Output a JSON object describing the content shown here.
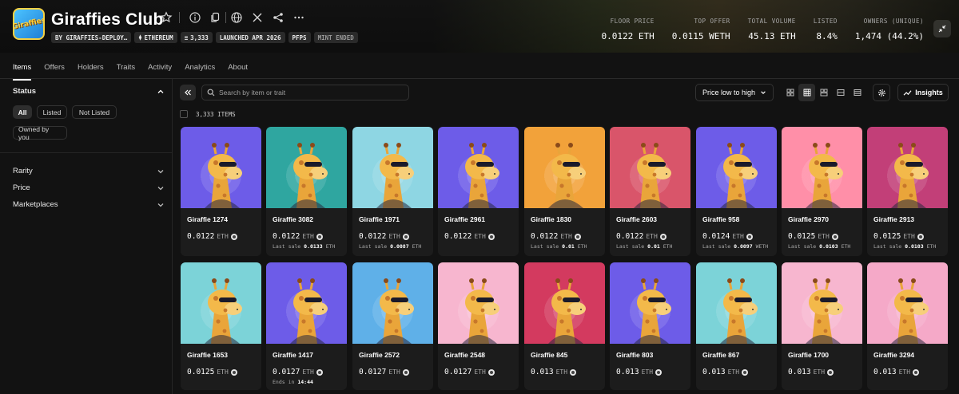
{
  "collection": {
    "logo_text": "Giraffies",
    "title": "Giraffies Club",
    "chips": [
      {
        "label": "BY GIRAFFIES-DEPLOY…",
        "icon": ""
      },
      {
        "label": "ETHEREUM",
        "icon": "ethereum-icon"
      },
      {
        "label": "3,333",
        "icon": "stack-icon"
      },
      {
        "label": "LAUNCHED APR 2026",
        "icon": ""
      },
      {
        "label": "PFPS",
        "icon": ""
      },
      {
        "label": "MINT ENDED",
        "icon": ""
      }
    ],
    "stats": [
      {
        "label": "FLOOR PRICE",
        "value": "0.0122 ETH"
      },
      {
        "label": "TOP OFFER",
        "value": "0.0115 WETH"
      },
      {
        "label": "TOTAL VOLUME",
        "value": "45.13 ETH"
      },
      {
        "label": "LISTED",
        "value": "8.4%"
      },
      {
        "label": "OWNERS (UNIQUE)",
        "value": "1,474 (44.2%)"
      }
    ]
  },
  "tabs": [
    "Items",
    "Offers",
    "Holders",
    "Traits",
    "Activity",
    "Analytics",
    "About"
  ],
  "sidebar": {
    "status_label": "Status",
    "status_options": [
      "All",
      "Listed",
      "Not Listed",
      "Owned by you"
    ],
    "filters": [
      "Rarity",
      "Price",
      "Marketplaces"
    ]
  },
  "toolbar": {
    "search_placeholder": "Search by item or trait",
    "sort_label": "Price low to high",
    "insights_label": "Insights",
    "items_count": "3,333 ITEMS"
  },
  "cards": [
    {
      "name": "Giraffie 1274",
      "price": "0.0122",
      "unit": "ETH",
      "sub_prefix": "",
      "sub_value": "",
      "sub_unit": ""
    },
    {
      "name": "Giraffie 3082",
      "price": "0.0122",
      "unit": "ETH",
      "sub_prefix": "Last sale",
      "sub_value": "0.0133",
      "sub_unit": "ETH"
    },
    {
      "name": "Giraffie 1971",
      "price": "0.0122",
      "unit": "ETH",
      "sub_prefix": "Last sale",
      "sub_value": "0.0087",
      "sub_unit": "ETH"
    },
    {
      "name": "Giraffie 2961",
      "price": "0.0122",
      "unit": "ETH",
      "sub_prefix": "",
      "sub_value": "",
      "sub_unit": ""
    },
    {
      "name": "Giraffie 1830",
      "price": "0.0122",
      "unit": "ETH",
      "sub_prefix": "Last sale",
      "sub_value": "0.01",
      "sub_unit": "ETH"
    },
    {
      "name": "Giraffie 2603",
      "price": "0.0122",
      "unit": "ETH",
      "sub_prefix": "Last sale",
      "sub_value": "0.01",
      "sub_unit": "ETH"
    },
    {
      "name": "Giraffie 958",
      "price": "0.0124",
      "unit": "ETH",
      "sub_prefix": "Last sale",
      "sub_value": "0.0097",
      "sub_unit": "WETH"
    },
    {
      "name": "Giraffie 2970",
      "price": "0.0125",
      "unit": "ETH",
      "sub_prefix": "Last sale",
      "sub_value": "0.0103",
      "sub_unit": "ETH"
    },
    {
      "name": "Giraffie 2913",
      "price": "0.0125",
      "unit": "ETH",
      "sub_prefix": "Last sale",
      "sub_value": "0.0103",
      "sub_unit": "ETH"
    },
    {
      "name": "Giraffie 1653",
      "price": "0.0125",
      "unit": "ETH",
      "sub_prefix": "",
      "sub_value": "",
      "sub_unit": ""
    },
    {
      "name": "Giraffie 1417",
      "price": "0.0127",
      "unit": "ETH",
      "sub_prefix": "Ends in",
      "sub_value": "14:44",
      "sub_unit": ""
    },
    {
      "name": "Giraffie 2572",
      "price": "0.0127",
      "unit": "ETH",
      "sub_prefix": "",
      "sub_value": "",
      "sub_unit": ""
    },
    {
      "name": "Giraffie 2548",
      "price": "0.0127",
      "unit": "ETH",
      "sub_prefix": "",
      "sub_value": "",
      "sub_unit": ""
    },
    {
      "name": "Giraffie 845",
      "price": "0.013",
      "unit": "ETH",
      "sub_prefix": "",
      "sub_value": "",
      "sub_unit": ""
    },
    {
      "name": "Giraffie 803",
      "price": "0.013",
      "unit": "ETH",
      "sub_prefix": "",
      "sub_value": "",
      "sub_unit": ""
    },
    {
      "name": "Giraffie 867",
      "price": "0.013",
      "unit": "ETH",
      "sub_prefix": "",
      "sub_value": "",
      "sub_unit": ""
    },
    {
      "name": "Giraffie 1700",
      "price": "0.013",
      "unit": "ETH",
      "sub_prefix": "",
      "sub_value": "",
      "sub_unit": ""
    },
    {
      "name": "Giraffie 3294",
      "price": "0.013",
      "unit": "ETH",
      "sub_prefix": "",
      "sub_value": "",
      "sub_unit": ""
    }
  ],
  "card_backgrounds": [
    "#6d5ce8",
    "#2fa6a0",
    "#8ed6e3",
    "#6d5ce8",
    "#f2a23a",
    "#d9556a",
    "#6d5ce8",
    "#ff8fa8",
    "#c23f78",
    "#7cd3d8",
    "#6d5ce8",
    "#5fb0e8",
    "#f7b6cf",
    "#d33a5f",
    "#6d5ce8",
    "#7cd3d8",
    "#f7b6cf",
    "#f5a9c8"
  ]
}
